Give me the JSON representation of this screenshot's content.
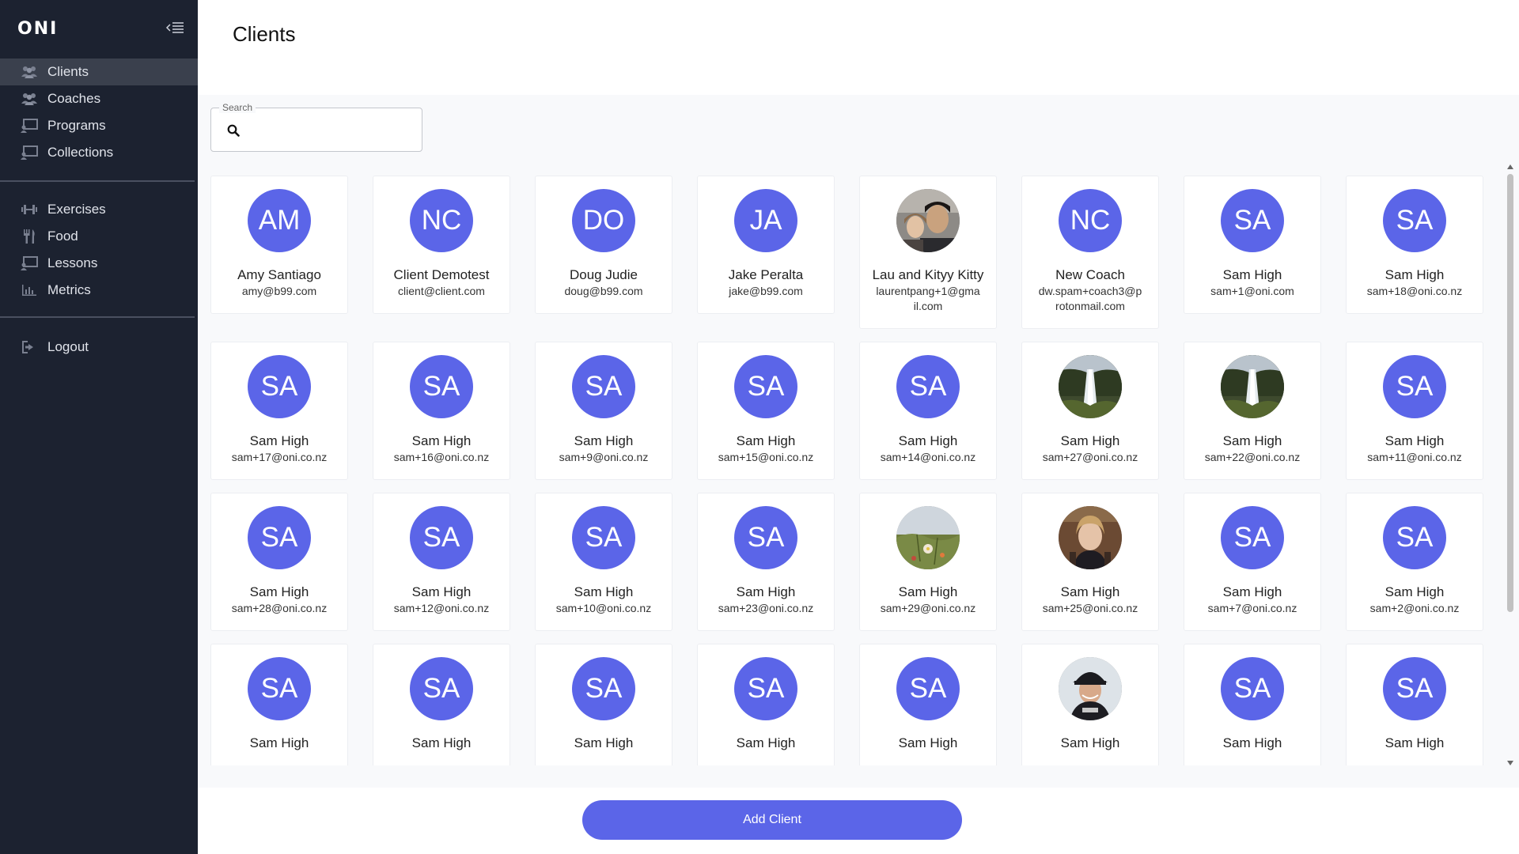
{
  "app": {
    "logo": "ONI"
  },
  "sidebar": {
    "primary": [
      {
        "label": "Clients",
        "icon": "users-icon",
        "active": true
      },
      {
        "label": "Coaches",
        "icon": "users-icon",
        "active": false
      },
      {
        "label": "Programs",
        "icon": "presentation-icon",
        "active": false
      },
      {
        "label": "Collections",
        "icon": "presentation-icon",
        "active": false
      }
    ],
    "secondary": [
      {
        "label": "Exercises",
        "icon": "dumbbell-icon"
      },
      {
        "label": "Food",
        "icon": "utensils-icon"
      },
      {
        "label": "Lessons",
        "icon": "presentation-icon"
      },
      {
        "label": "Metrics",
        "icon": "chart-bar-icon"
      }
    ],
    "logout": {
      "label": "Logout",
      "icon": "logout-icon"
    }
  },
  "page": {
    "title": "Clients"
  },
  "search": {
    "label": "Search",
    "placeholder": "",
    "value": ""
  },
  "clients": [
    {
      "initials": "AM",
      "name": "Amy Santiago",
      "email": "amy@b99.com"
    },
    {
      "initials": "NC",
      "name": "Client Demotest",
      "email": "client@client.com"
    },
    {
      "initials": "DO",
      "name": "Doug Judie",
      "email": "doug@b99.com"
    },
    {
      "initials": "JA",
      "name": "Jake Peralta",
      "email": "jake@b99.com"
    },
    {
      "initials": "",
      "photo": "couple-selfie",
      "name": "Lau and Kityy Kitty",
      "email": "laurentpang+1@gmail.com"
    },
    {
      "initials": "NC",
      "name": "New Coach",
      "email": "dw.spam+coach3@protonmail.com"
    },
    {
      "initials": "SA",
      "name": "Sam High",
      "email": "sam+1@oni.com"
    },
    {
      "initials": "SA",
      "name": "Sam High",
      "email": "sam+18@oni.co.nz"
    },
    {
      "initials": "SA",
      "name": "Sam High",
      "email": "sam+17@oni.co.nz"
    },
    {
      "initials": "SA",
      "name": "Sam High",
      "email": "sam+16@oni.co.nz"
    },
    {
      "initials": "SA",
      "name": "Sam High",
      "email": "sam+9@oni.co.nz"
    },
    {
      "initials": "SA",
      "name": "Sam High",
      "email": "sam+15@oni.co.nz"
    },
    {
      "initials": "SA",
      "name": "Sam High",
      "email": "sam+14@oni.co.nz"
    },
    {
      "initials": "",
      "photo": "waterfall",
      "name": "Sam High",
      "email": "sam+27@oni.co.nz"
    },
    {
      "initials": "",
      "photo": "waterfall",
      "name": "Sam High",
      "email": "sam+22@oni.co.nz"
    },
    {
      "initials": "SA",
      "name": "Sam High",
      "email": "sam+11@oni.co.nz"
    },
    {
      "initials": "SA",
      "name": "Sam High",
      "email": "sam+28@oni.co.nz"
    },
    {
      "initials": "SA",
      "name": "Sam High",
      "email": "sam+12@oni.co.nz"
    },
    {
      "initials": "SA",
      "name": "Sam High",
      "email": "sam+10@oni.co.nz"
    },
    {
      "initials": "SA",
      "name": "Sam High",
      "email": "sam+23@oni.co.nz"
    },
    {
      "initials": "",
      "photo": "flowers",
      "name": "Sam High",
      "email": "sam+29@oni.co.nz"
    },
    {
      "initials": "",
      "photo": "person-portrait",
      "name": "Sam High",
      "email": "sam+25@oni.co.nz"
    },
    {
      "initials": "SA",
      "name": "Sam High",
      "email": "sam+7@oni.co.nz"
    },
    {
      "initials": "SA",
      "name": "Sam High",
      "email": "sam+2@oni.co.nz"
    },
    {
      "initials": "SA",
      "name": "Sam High",
      "email": ""
    },
    {
      "initials": "SA",
      "name": "Sam High",
      "email": ""
    },
    {
      "initials": "SA",
      "name": "Sam High",
      "email": ""
    },
    {
      "initials": "SA",
      "name": "Sam High",
      "email": ""
    },
    {
      "initials": "SA",
      "name": "Sam High",
      "email": ""
    },
    {
      "initials": "",
      "photo": "person-cap",
      "name": "Sam High",
      "email": ""
    },
    {
      "initials": "SA",
      "name": "Sam High",
      "email": ""
    },
    {
      "initials": "SA",
      "name": "Sam High",
      "email": ""
    }
  ],
  "actions": {
    "add_client": "Add Client"
  },
  "colors": {
    "sidebar_bg": "#1c2230",
    "accent": "#5b65e8",
    "active_item": "#3a404d"
  }
}
